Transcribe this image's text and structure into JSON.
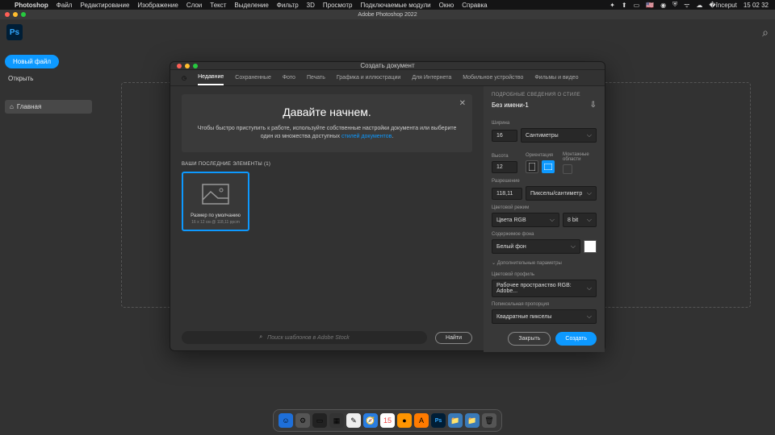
{
  "menubar": {
    "app": "Photoshop",
    "items": [
      "Файл",
      "Редактирование",
      "Изображение",
      "Слои",
      "Текст",
      "Выделение",
      "Фильтр",
      "3D",
      "Просмотр",
      "Подключаемые модули",
      "Окно",
      "Справка"
    ],
    "time": "15 02 32"
  },
  "window": {
    "title": "Adobe Photoshop 2022"
  },
  "sidebar": {
    "new_file": "Новый файл",
    "open": "Открыть",
    "home": "Главная"
  },
  "dialog": {
    "title": "Создать документ",
    "tabs": [
      "Недавние",
      "Сохраненные",
      "Фото",
      "Печать",
      "Графика и иллюстрации",
      "Для Интернета",
      "Мобильное устройство",
      "Фильмы и видео"
    ],
    "hero": {
      "title": "Давайте начнем.",
      "text": "Чтобы быстро приступить к работе, используйте собственные настройки документа или выберите один из множества доступных ",
      "link": "стилей документов"
    },
    "recent_label": "ВАШИ ПОСЛЕДНИЕ ЭЛЕМЕНТЫ  (1)",
    "preset": {
      "name": "Размер по умолчанию",
      "sub": "16 x 12 см @ 118,11 ppcm"
    },
    "search": {
      "placeholder": "Поиск шаблонов в Adobe Stock",
      "find": "Найти"
    },
    "details": {
      "header": "ПОДРОБНЫЕ СВЕДЕНИЯ О СТИЛЕ",
      "name": "Без имени-1",
      "width_label": "Ширина",
      "width": "16",
      "unit": "Сантиметры",
      "height_label": "Высота",
      "height": "12",
      "orient_label": "Ориентация",
      "artboards_label": "Монтажные области",
      "res_label": "Разрешение",
      "res": "118,11",
      "res_unit": "Пикселы/сантиметр",
      "mode_label": "Цветовой режим",
      "mode": "Цвета RGB",
      "depth": "8 bit",
      "bg_label": "Содержимое фона",
      "bg": "Белый фон",
      "advanced": "Дополнительные параметры",
      "profile_label": "Цветовой профиль",
      "profile": "Рабочее пространство RGB: Adobe...",
      "aspect_label": "Попиксельная пропорция",
      "aspect": "Квадратные пикселы",
      "close": "Закрыть",
      "create": "Создать"
    }
  }
}
